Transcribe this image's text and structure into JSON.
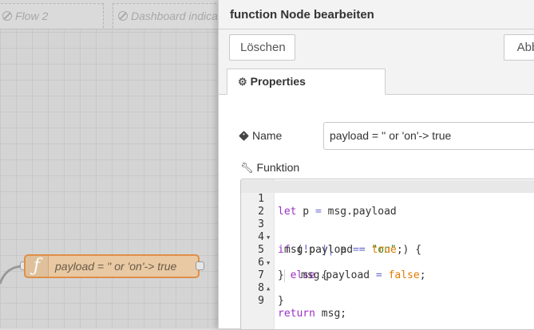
{
  "workspace": {
    "tabs": [
      {
        "label": "Flow 2"
      },
      {
        "label": "Dashboard indica"
      }
    ],
    "node": {
      "label": "payload = '' or 'on'-> true",
      "icon": "function-icon"
    }
  },
  "panel": {
    "title": "function Node bearbeiten",
    "buttons": {
      "delete": "Löschen",
      "cancel": "Abb"
    },
    "tab": "Properties",
    "name_label": "Name",
    "name_value": "payload = '' or 'on'-> true",
    "function_label": "Funktion"
  },
  "editor": {
    "lines": [
      {
        "n": "1",
        "fold": ""
      },
      {
        "n": "2",
        "fold": ""
      },
      {
        "n": "3",
        "fold": "▼"
      },
      {
        "n": "4",
        "fold": ""
      },
      {
        "n": "5",
        "fold": "▼"
      },
      {
        "n": "6",
        "fold": ""
      },
      {
        "n": "7",
        "fold": "▲"
      },
      {
        "n": "8",
        "fold": ""
      },
      {
        "n": "9",
        "fold": ""
      }
    ],
    "tokens": {
      "l1_kw": "let",
      "l1_a": " p ",
      "l1_op": "=",
      "l1_b": " msg.payload",
      "l3_kw": "if",
      "l3_a": " (",
      "l3_op1": "!",
      "l3_b": "p ",
      "l3_op2": "||",
      "l3_c": " p ",
      "l3_op3": "==",
      "l3_d": " ",
      "l3_str": "\"on\"",
      "l3_e": " ) {",
      "l4_a": "msg.payload ",
      "l4_op": "=",
      "l4_b": " ",
      "l4_bool": "true",
      "l4_c": ";",
      "l5_a": "} ",
      "l5_kw": "else",
      "l5_b": " {",
      "l6_a": "msg.payload ",
      "l6_op": "=",
      "l6_b": " ",
      "l6_bool": "false",
      "l6_c": ";",
      "l7_a": "}",
      "l9_kw": "return",
      "l9_a": " msg;"
    }
  }
}
